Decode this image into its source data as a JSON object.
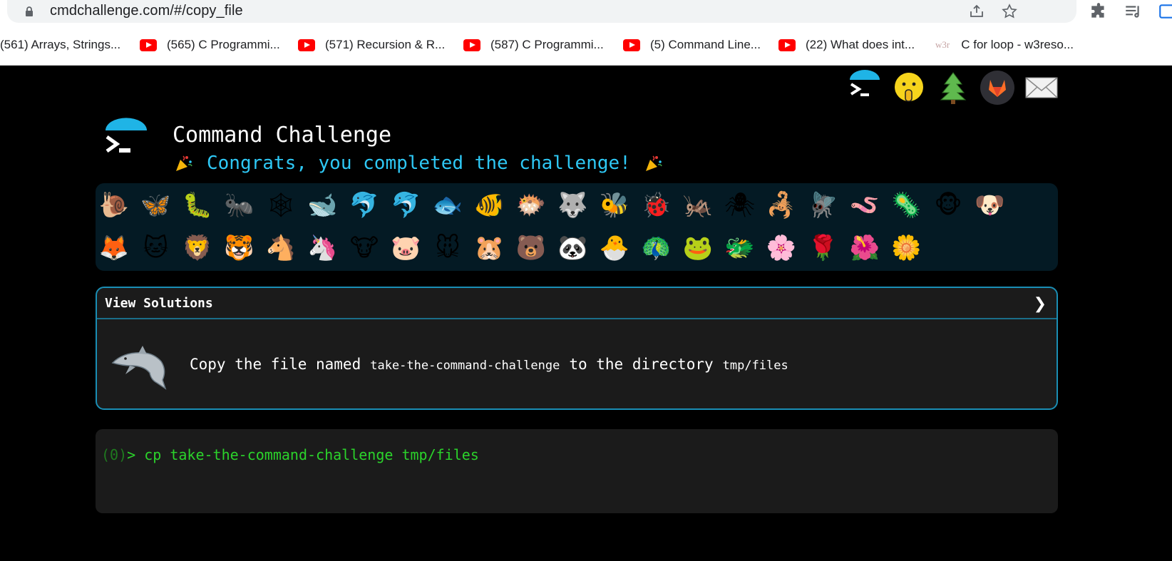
{
  "browser": {
    "url": "cmdchallenge.com/#/copy_file",
    "bookmarks": [
      {
        "label": "(561) Arrays, Strings...",
        "icon": "none"
      },
      {
        "label": "(565) C Programmi...",
        "icon": "youtube-icon"
      },
      {
        "label": "(571) Recursion & R...",
        "icon": "youtube-icon"
      },
      {
        "label": "(587) C Programmi...",
        "icon": "youtube-icon"
      },
      {
        "label": "(5) Command Line...",
        "icon": "youtube-icon"
      },
      {
        "label": "(22) What does int...",
        "icon": "youtube-icon"
      },
      {
        "label": "C for loop - w3reso...",
        "icon": "w3r-icon",
        "icon_text": "w3r"
      }
    ]
  },
  "header": {
    "title": "Command Challenge",
    "congrats": "Congrats, you completed the challenge!",
    "top_icons": [
      "cmd-logo-icon",
      "shushing-face-icon",
      "tree-icon",
      "gitlab-icon",
      "mail-icon"
    ]
  },
  "emojis": {
    "row1": [
      "🐌",
      "🦋",
      "🐛",
      "🐜",
      "🕸",
      "🐋",
      "🐬",
      "🐬",
      "🐟",
      "🐠",
      "🐡",
      "🐺",
      "🐝",
      "🐞",
      "🦗",
      "🕷",
      "🦂",
      "🪰",
      "🪱",
      "🦠",
      "🐵",
      "🐶"
    ],
    "row2": [
      "🦊",
      "🐱",
      "🦁",
      "🐯",
      "🐴",
      "🦄",
      "🐮",
      "🐷",
      "🐭",
      "🐹",
      "🐻",
      "🐼",
      "🐣",
      "🦚",
      "🐸",
      "🐲",
      "🌸",
      "🌹",
      "🌺",
      "🌼"
    ]
  },
  "solutions": {
    "header_label": "View Solutions",
    "chevron": "❯",
    "task_prefix": "Copy the file named",
    "task_file": "take-the-command-challenge",
    "task_middle": "to the directory",
    "task_dir": "tmp/files"
  },
  "terminal": {
    "return_code": "(0)",
    "prompt_symbol": ">",
    "command": "cp take-the-command-challenge tmp/files"
  },
  "colors": {
    "accent": "#2ec8f5",
    "panel_border": "#1a8eb5",
    "terminal_green": "#2bd32b"
  }
}
